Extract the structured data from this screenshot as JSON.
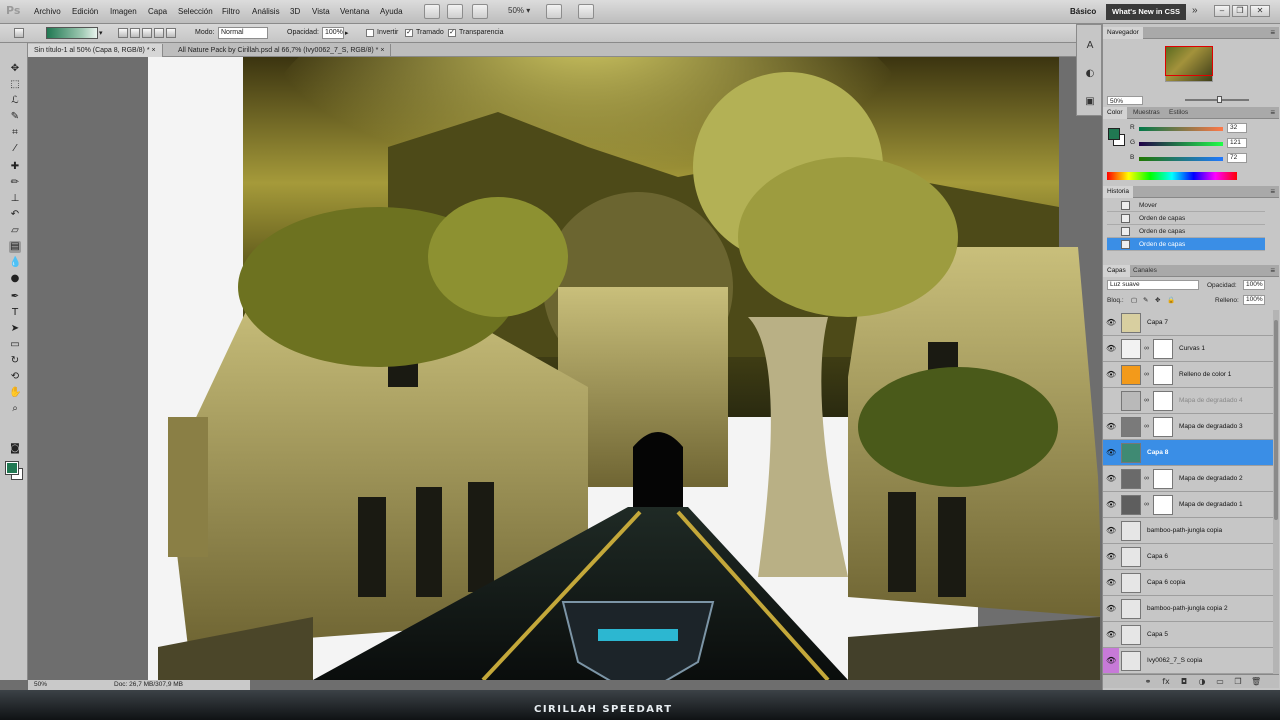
{
  "app": {
    "logo": "Ps"
  },
  "menu": [
    "Archivo",
    "Edición",
    "Imagen",
    "Capa",
    "Selección",
    "Filtro",
    "Análisis",
    "3D",
    "Vista",
    "Ventana",
    "Ayuda"
  ],
  "menubar": {
    "zoom": "50%",
    "workspace": "Básico",
    "whats_new": "What's New in CSS",
    "more": "»",
    "window_buttons": [
      "–",
      "❐",
      "✕"
    ]
  },
  "options": {
    "mode_label": "Modo:",
    "mode_value": "Normal",
    "opacity_label": "Opacidad:",
    "opacity_value": "100%",
    "reverse_label": "Invertir",
    "dither_label": "Tramado",
    "transparency_label": "Transparencia",
    "dither_checked": "✓",
    "transparency_checked": "✓"
  },
  "tabs": [
    {
      "label": "Sin título-1 al 50% (Capa 8, RGB/8) *",
      "close": "×"
    },
    {
      "label": "All Nature Pack by Cirillah.psd al 66,7% (Ivy0062_7_S, RGB/8) *",
      "close": "×"
    }
  ],
  "status": {
    "zoom": "50%",
    "doc": "Doc: 26,7 MB/307,9 MB"
  },
  "footer": {
    "title": "CIRILLAH SPEEDART"
  },
  "panels": {
    "navigator": {
      "tabs": [
        "Navegador"
      ],
      "zoom": "50%"
    },
    "color": {
      "tabs": [
        "Color",
        "Muestras",
        "Estilos"
      ],
      "channels": [
        {
          "label": "R",
          "value": "32"
        },
        {
          "label": "G",
          "value": "121"
        },
        {
          "label": "B",
          "value": "72"
        }
      ],
      "fg": "#207848"
    },
    "history": {
      "tabs": [
        "Historia"
      ],
      "items": [
        "Mover",
        "Orden de capas",
        "Orden de capas",
        "Orden de capas"
      ],
      "selected_index": 3
    },
    "layers": {
      "tabs": [
        "Capas",
        "Canales"
      ],
      "blend_mode": "Luz suave",
      "opacity_label": "Opacidad:",
      "opacity_value": "100%",
      "lock_label": "Bloq.:",
      "fill_label": "Relleno:",
      "fill_value": "100%",
      "items": [
        {
          "name": "Capa 7",
          "visible": true,
          "thumb": "#d8cfa0",
          "mask": false
        },
        {
          "name": "Curvas 1",
          "visible": true,
          "thumb": "#f2f2f2",
          "mask": true
        },
        {
          "name": "Relleno de color 1",
          "visible": true,
          "thumb": "#f39a1a",
          "mask": true
        },
        {
          "name": "Mapa de degradado 4",
          "visible": false,
          "thumb": "#b9b9b9",
          "mask": true
        },
        {
          "name": "Mapa de degradado 3",
          "visible": true,
          "thumb": "#7a7a7a",
          "mask": true
        },
        {
          "name": "Capa 8",
          "visible": true,
          "thumb": "#3f8a73",
          "mask": false,
          "selected": true
        },
        {
          "name": "Mapa de degradado 2",
          "visible": true,
          "thumb": "#6a6a6a",
          "mask": true
        },
        {
          "name": "Mapa de degradado 1",
          "visible": true,
          "thumb": "#5e5e5e",
          "mask": true
        },
        {
          "name": "bamboo-path-jungla copia",
          "visible": true,
          "thumb": "#e6e6e6",
          "mask": false
        },
        {
          "name": "Capa 6",
          "visible": true,
          "thumb": "#e6e6e6",
          "mask": false
        },
        {
          "name": "Capa 6 copia",
          "visible": true,
          "thumb": "#e6e6e6",
          "mask": false
        },
        {
          "name": "bamboo-path-jungla copia 2",
          "visible": true,
          "thumb": "#e6e6e6",
          "mask": false
        },
        {
          "name": "Capa 5",
          "visible": true,
          "thumb": "#e6e6e6",
          "mask": false
        },
        {
          "name": "Ivy0062_7_S copia",
          "visible": true,
          "thumb": "#e6e6e6",
          "mask": false,
          "tag": "#c77ad8"
        }
      ]
    }
  },
  "icons": {
    "tools": [
      "move-tool-icon",
      "marquee-tool-icon",
      "lasso-tool-icon",
      "quick-selection-icon",
      "crop-tool-icon",
      "eyedropper-icon",
      "healing-brush-icon",
      "brush-tool-icon",
      "clone-stamp-icon",
      "history-brush-icon",
      "eraser-icon",
      "gradient-tool-icon",
      "blur-tool-icon",
      "dodge-tool-icon",
      "pen-tool-icon",
      "type-tool-icon",
      "path-selection-icon",
      "shape-tool-icon",
      "3d-rotate-icon",
      "3d-orbit-icon",
      "hand-tool-icon",
      "zoom-tool-icon"
    ]
  }
}
